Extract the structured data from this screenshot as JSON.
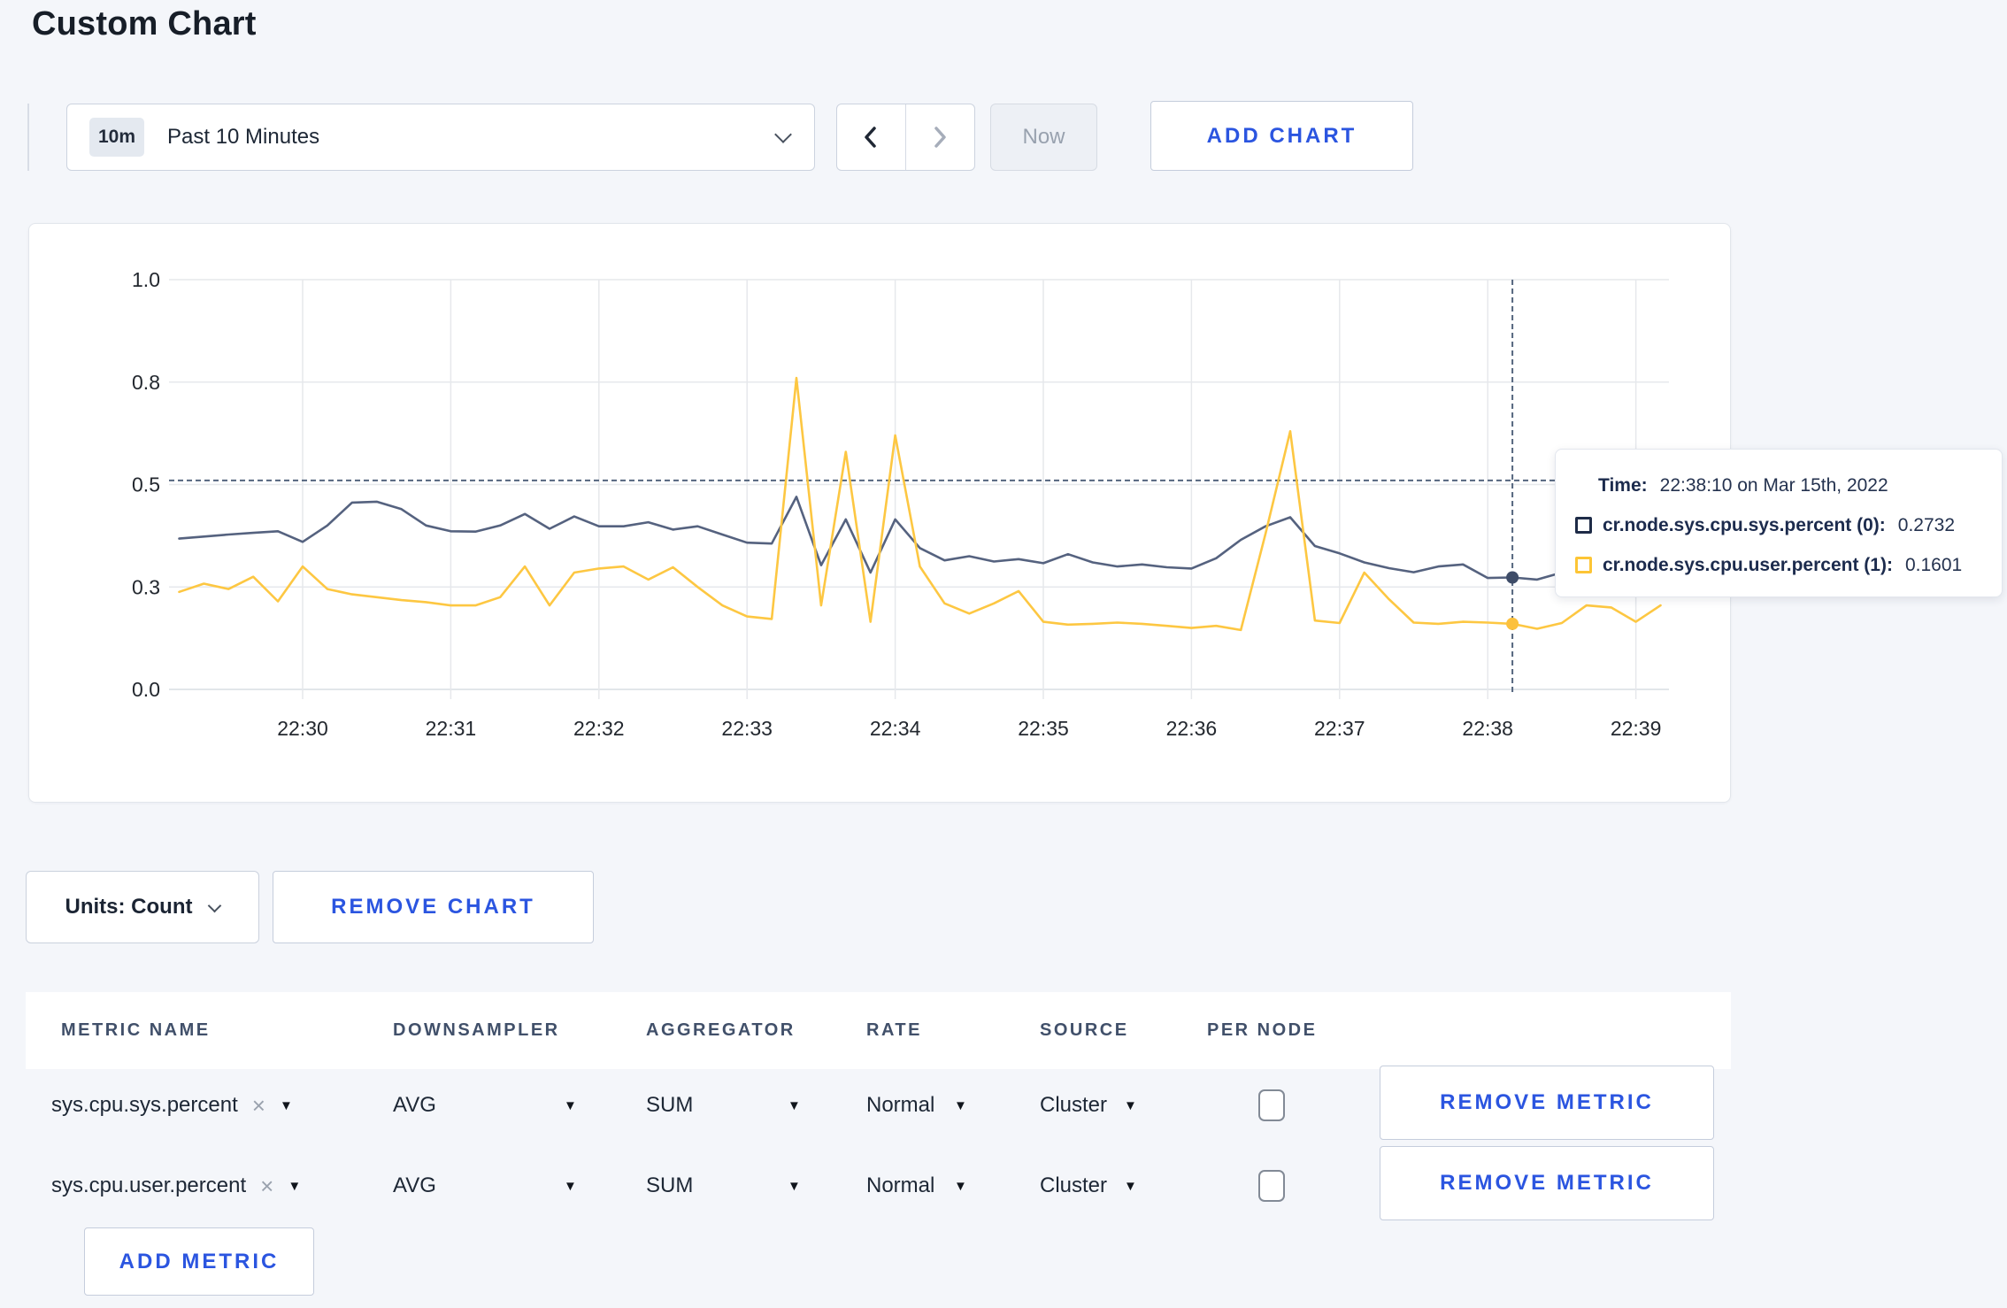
{
  "page": {
    "title": "Custom Chart"
  },
  "icons": {
    "caret_down": "▼",
    "clear": "×"
  },
  "toolbar": {
    "time_range": {
      "badge": "10m",
      "label": "Past 10 Minutes"
    },
    "now_label": "Now",
    "add_chart_label": "ADD CHART"
  },
  "chart_data": {
    "type": "line",
    "x_start": "22:29:10",
    "x_interval_seconds": 10,
    "x_tick_labels": [
      "22:30",
      "22:31",
      "22:32",
      "22:33",
      "22:34",
      "22:35",
      "22:36",
      "22:37",
      "22:38",
      "22:39"
    ],
    "y_ticks_actual": [
      1,
      0.75,
      0.5,
      0.25,
      0
    ],
    "y_tick_labels": [
      "1.0",
      "0.8",
      "0.5",
      "0.3",
      "0.0"
    ],
    "ylim": [
      0,
      1
    ],
    "grid": true,
    "series": [
      {
        "name": "cr.node.sys.cpu.sys.percent (0)",
        "color": "#55627f",
        "dot_color": "#3e4c68",
        "values": [
          0.368,
          0.373,
          0.378,
          0.382,
          0.386,
          0.36,
          0.4,
          0.456,
          0.458,
          0.44,
          0.4,
          0.386,
          0.385,
          0.4,
          0.428,
          0.392,
          0.422,
          0.398,
          0.398,
          0.408,
          0.39,
          0.398,
          0.378,
          0.358,
          0.356,
          0.47,
          0.303,
          0.415,
          0.285,
          0.415,
          0.345,
          0.315,
          0.325,
          0.312,
          0.318,
          0.308,
          0.33,
          0.31,
          0.3,
          0.305,
          0.298,
          0.295,
          0.32,
          0.365,
          0.398,
          0.42,
          0.35,
          0.332,
          0.31,
          0.296,
          0.286,
          0.3,
          0.305,
          0.272,
          0.2732,
          0.268,
          0.285,
          0.298,
          0.306,
          0.298,
          0.306
        ]
      },
      {
        "name": "cr.node.sys.cpu.user.percent (1)",
        "color": "#fdc742",
        "dot_color": "#fcc13e",
        "values": [
          0.238,
          0.258,
          0.245,
          0.275,
          0.215,
          0.3,
          0.245,
          0.232,
          0.225,
          0.218,
          0.213,
          0.205,
          0.205,
          0.225,
          0.3,
          0.205,
          0.285,
          0.295,
          0.3,
          0.268,
          0.298,
          0.25,
          0.205,
          0.178,
          0.172,
          0.76,
          0.205,
          0.58,
          0.165,
          0.62,
          0.3,
          0.21,
          0.185,
          0.21,
          0.24,
          0.165,
          0.158,
          0.16,
          0.163,
          0.16,
          0.155,
          0.15,
          0.155,
          0.145,
          0.38,
          0.63,
          0.168,
          0.162,
          0.285,
          0.22,
          0.163,
          0.16,
          0.165,
          0.163,
          0.1601,
          0.148,
          0.162,
          0.205,
          0.2,
          0.165,
          0.205
        ]
      }
    ],
    "crosshair": {
      "time": "22:38:10",
      "x_index": 54,
      "y_value": 0.51,
      "dot_values": [
        0.2732,
        0.1601
      ]
    }
  },
  "tooltip": {
    "time_label": "Time:",
    "time_value": "22:38:10 on Mar 15th, 2022",
    "series": [
      {
        "label": "cr.node.sys.cpu.sys.percent (0):",
        "value": "0.2732",
        "swatch_color": "#1e2b47"
      },
      {
        "label": "cr.node.sys.cpu.user.percent (1):",
        "value": "0.1601",
        "swatch_color": "#fdc535"
      }
    ]
  },
  "units_bar": {
    "units_label": "Units: Count",
    "remove_chart_label": "REMOVE CHART"
  },
  "metrics_table": {
    "headers": [
      "METRIC NAME",
      "DOWNSAMPLER",
      "AGGREGATOR",
      "RATE",
      "SOURCE",
      "PER NODE"
    ],
    "rows": [
      {
        "metric": "sys.cpu.sys.percent",
        "downsampler": "AVG",
        "aggregator": "SUM",
        "rate": "Normal",
        "source": "Cluster",
        "per_node_checked": false,
        "remove_label": "REMOVE METRIC"
      },
      {
        "metric": "sys.cpu.user.percent",
        "downsampler": "AVG",
        "aggregator": "SUM",
        "rate": "Normal",
        "source": "Cluster",
        "per_node_checked": false,
        "remove_label": "REMOVE METRIC"
      }
    ],
    "add_metric_label": "ADD METRIC"
  }
}
